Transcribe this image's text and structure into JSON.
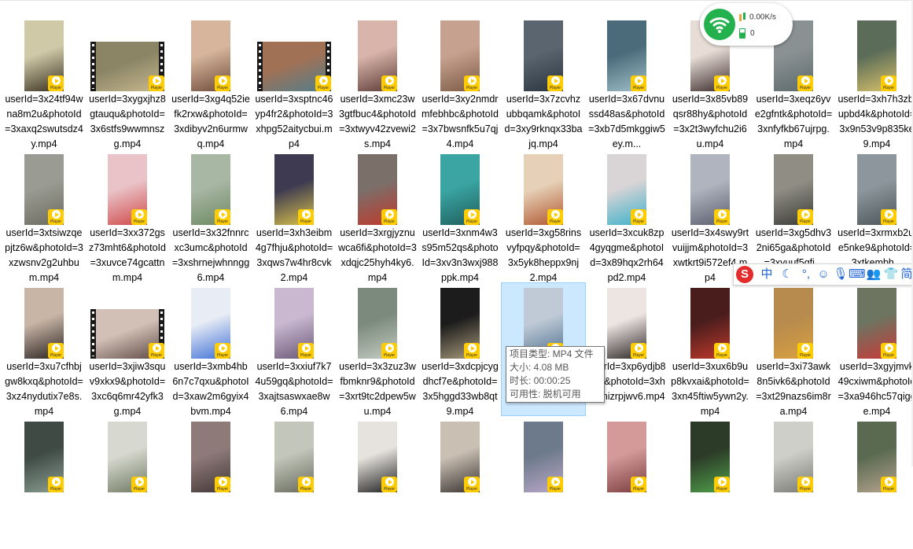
{
  "badge_text": "Player",
  "files": [
    {
      "name": "userId=3x24tf94wna8m2u&photoId=3xaxq2swutsdz4y.mp4",
      "orient": "portrait",
      "bg": "#cfc9a8",
      "fg": "#3a3120",
      "film": false
    },
    {
      "name": "userId=3xygxjhz8gtauqu&photoId=3x6stfs9wwmnszg.mp4",
      "orient": "landscape",
      "bg": "#8b8566",
      "fg": "#c9b98f",
      "film": true
    },
    {
      "name": "userId=3xg4q52iefk2rxw&photoId=3xdibyv2n6urmwq.mp4",
      "orient": "portrait",
      "bg": "#d6b59c",
      "fg": "#6e4b3a",
      "film": false
    },
    {
      "name": "userId=3xsptnc46yp4fr2&photoId=3xhpg52aitycbui.mp4",
      "orient": "landscape",
      "bg": "#a07155",
      "fg": "#4f7f8e",
      "film": true
    },
    {
      "name": "userId=3xmc23w3gtfbuc4&photoId=3xtwyv42zvewi2s.mp4",
      "orient": "portrait",
      "bg": "#d8b4aa",
      "fg": "#5c3b36",
      "film": false
    },
    {
      "name": "userId=3xy2nmdrmfebhbc&photoId=3x7bwsnfk5u7qj4.mp4",
      "orient": "portrait",
      "bg": "#c7a18f",
      "fg": "#7b5a44",
      "film": false
    },
    {
      "name": "userId=3x7zcvhzubbqamk&photoId=3xy9rknqx33bajq.mp4",
      "orient": "portrait",
      "bg": "#5a6570",
      "fg": "#2a3540",
      "film": false
    },
    {
      "name": "userId=3x67dvnussd48as&photoId=3xb7d5mkggiw5ey.m...",
      "orient": "portrait",
      "bg": "#4b6b7a",
      "fg": "#9fbfc9",
      "film": false
    },
    {
      "name": "userId=3x85vb89qsr88hy&photoId=3x2t3wyfchu2i6u.mp4",
      "orient": "portrait",
      "bg": "#e7dcd6",
      "fg": "#3a2b2a",
      "film": false
    },
    {
      "name": "userId=3xeqz6yve2gfntk&photoId=3xnfyfkb67ujrpg.mp4",
      "orient": "portrait",
      "bg": "#8a9193",
      "fg": "#5d6a6b",
      "film": false
    },
    {
      "name": "userId=3xh7h3zbiupbd4k&photoId=3x9n53v9p835ke9.mp4",
      "orient": "portrait",
      "bg": "#5b6c58",
      "fg": "#d7c16b",
      "film": false
    },
    {
      "name": "userId=3xtsiwzqepjtz6w&photoId=3xzwsnv2g2uhbum.mp4",
      "orient": "portrait",
      "bg": "#9a9b92",
      "fg": "#6c6c61",
      "film": false
    },
    {
      "name": "userId=3xx372gsz73mht6&photoId=3xuvce74gcattnm.mp4",
      "orient": "portrait",
      "bg": "#e9c3c8",
      "fg": "#d04848",
      "film": false
    },
    {
      "name": "userId=3x32fnnrcxc3umc&photoId=3xshrnejwhnngg6.mp4",
      "orient": "portrait",
      "bg": "#a8b6a4",
      "fg": "#6d8a62",
      "film": false
    },
    {
      "name": "userId=3xh3eibm4g7fhju&photoId=3xqws7w4hr8cvk2.mp4",
      "orient": "portrait",
      "bg": "#3d3a52",
      "fg": "#d9c24a",
      "film": false
    },
    {
      "name": "userId=3xrgjyznuwca6fi&photoId=3xdqjc25hyh4ky6.mp4",
      "orient": "portrait",
      "bg": "#7b6f6a",
      "fg": "#c0392b",
      "film": false
    },
    {
      "name": "userId=3xnm4w3s95m52qs&photoId=3xv3n3wxj988ppk.mp4",
      "orient": "portrait",
      "bg": "#3aa5a3",
      "fg": "#1f5e5d",
      "film": false
    },
    {
      "name": "userId=3xg58rinsvyfpqy&photoId=3x5yk8heppx9nj2.mp4",
      "orient": "portrait",
      "bg": "#e6d1b8",
      "fg": "#b0562f",
      "film": false
    },
    {
      "name": "userId=3xcuk8zp4gyqgme&photoId=3x89hqx2rh64pd2.mp4",
      "orient": "portrait",
      "bg": "#d9d4d6",
      "fg": "#3bb1c9",
      "film": false
    },
    {
      "name": "userId=3x4swy9rtvuijjm&photoId=3xwtkrt9i572ef4.mp4",
      "orient": "portrait",
      "bg": "#b0b4bf",
      "fg": "#5b5f6e",
      "film": false
    },
    {
      "name": "userId=3xg5dhv32ni65ga&photoId=3xyuuf5gfi...",
      "orient": "portrait",
      "bg": "#8f8d84",
      "fg": "#3a3b36",
      "film": false
    },
    {
      "name": "userId=3xrmxb2uje5nke9&photoId=3xtkembh...",
      "orient": "portrait",
      "bg": "#8c969c",
      "fg": "#4c5559",
      "film": false
    },
    {
      "name": "userId=3xu7cfhbjgw8kxq&photoId=3xz4nydutix7e8s.mp4",
      "orient": "portrait",
      "bg": "#c8b5a6",
      "fg": "#2a2220",
      "film": false
    },
    {
      "name": "userId=3xjiw3squv9xkx9&photoId=3xc6q6mr42yfk3g.mp4",
      "orient": "landscape",
      "bg": "#d2c0b6",
      "fg": "#5a4640",
      "film": true
    },
    {
      "name": "userId=3xmb4hb6n7c7qxu&photoId=3xaw2m6gyix4bvm.mp4",
      "orient": "portrait",
      "bg": "#e8edf5",
      "fg": "#3f6fd6",
      "film": false
    },
    {
      "name": "userId=3xxiuf7k74u59gq&photoId=3xajtsaswxae8w6.mp4",
      "orient": "portrait",
      "bg": "#c9b8d0",
      "fg": "#6a5778",
      "film": false
    },
    {
      "name": "userId=3x3zuz3wfbmknr9&photoId=3xrt9tc2dpew5wu.mp4",
      "orient": "portrait",
      "bg": "#7b8a7c",
      "fg": "#c5cbc3",
      "film": false
    },
    {
      "name": "userId=3xdcpjcygdhcf7e&photoId=3x5hggd33wb8qt9.mp4",
      "orient": "portrait",
      "bg": "#1c1c1c",
      "fg": "#a89a7c",
      "film": false
    },
    {
      "name": "userId=3x...643aw.mp4",
      "orient": "portrait",
      "bg": "#bfcad6",
      "fg": "#4c6e8e",
      "film": false
    },
    {
      "name": "userId=3xp6ydjb8y46&photoId=3xhtq7nizrpjwv6.mp4",
      "orient": "portrait",
      "bg": "#ece5e2",
      "fg": "#2b2525",
      "film": false
    },
    {
      "name": "userId=3xux6b9up8kvxai&photoId=3xn45ftiw5ywn2y.mp4",
      "orient": "portrait",
      "bg": "#4a1d1d",
      "fg": "#c0392b",
      "film": false
    },
    {
      "name": "userId=3xi73awk8n5ivk6&photoId=3xt29nazs6im8ra.mp4",
      "orient": "portrait",
      "bg": "#b78b4e",
      "fg": "#d9a040",
      "film": false
    },
    {
      "name": "userId=3xgyjmvk49cxiwm&photoId=3xa946hc57qigge.mp4",
      "orient": "portrait",
      "bg": "#6d7460",
      "fg": "#c93a3a",
      "film": false
    },
    {
      "name": "",
      "orient": "portrait",
      "bg": "#3f4a45",
      "fg": "#8a9f92",
      "film": false
    },
    {
      "name": "",
      "orient": "portrait",
      "bg": "#d7d8cf",
      "fg": "#6f7a62",
      "film": false
    },
    {
      "name": "",
      "orient": "portrait",
      "bg": "#8f7a7a",
      "fg": "#443838",
      "film": false
    },
    {
      "name": "",
      "orient": "portrait",
      "bg": "#c3c7bb",
      "fg": "#676a5d",
      "film": false
    },
    {
      "name": "",
      "orient": "portrait",
      "bg": "#e6e3de",
      "fg": "#1f1f1f",
      "film": false
    },
    {
      "name": "",
      "orient": "portrait",
      "bg": "#c9bfb3",
      "fg": "#3a3330",
      "film": false
    },
    {
      "name": "",
      "orient": "portrait",
      "bg": "#6d7a8b",
      "fg": "#b9a7c9",
      "film": false
    },
    {
      "name": "",
      "orient": "portrait",
      "bg": "#d49a9a",
      "fg": "#7b3d3d",
      "film": false
    },
    {
      "name": "",
      "orient": "portrait",
      "bg": "#2c3a28",
      "fg": "#4fa04a",
      "film": false
    },
    {
      "name": "",
      "orient": "portrait",
      "bg": "#cfcfca",
      "fg": "#7a7a74",
      "film": false
    },
    {
      "name": "",
      "orient": "portrait",
      "bg": "#5a6a50",
      "fg": "#b5a38d",
      "film": false
    }
  ],
  "selected_index": 28,
  "network": {
    "speed": "0.00K/s",
    "count": "0"
  },
  "ime": {
    "logo": "S",
    "items": [
      "中",
      "☾",
      "°,",
      "☺",
      "🎙",
      "⌨",
      "👥",
      "👕",
      "简"
    ]
  },
  "tooltip": {
    "type": "项目类型: MP4 文件",
    "size": "大小: 4.08 MB",
    "duration": "时长: 00:00:25",
    "availability": "可用性: 脱机可用"
  }
}
